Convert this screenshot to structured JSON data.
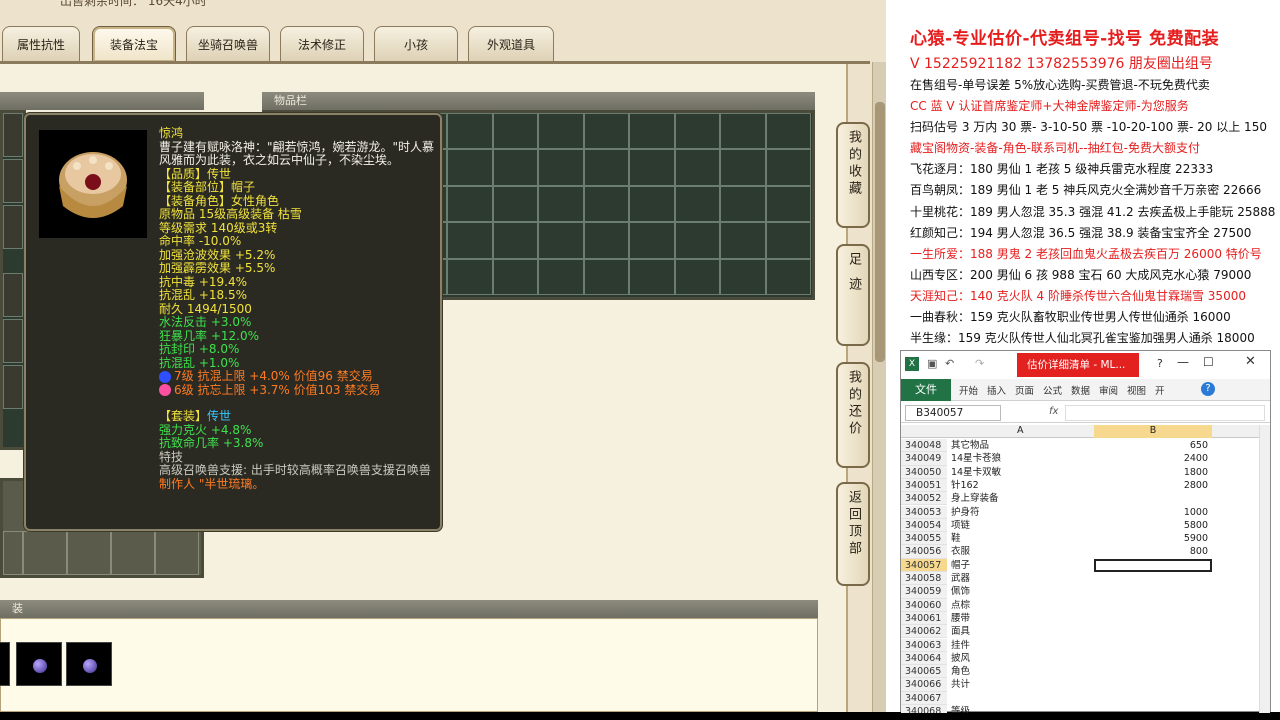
{
  "game": {
    "top_text": "出售剩余时间：  16天4小时",
    "tabs": [
      "属性抗性",
      "装备法宝",
      "坐骑召唤兽",
      "法术修正",
      "小孩",
      "外观道具"
    ],
    "active_tab": "装备法宝",
    "inventory_header": "物品栏",
    "bottom_section_header": "装",
    "side_buttons": [
      "我的收藏",
      "足迹",
      "我的还价",
      "返回顶部"
    ]
  },
  "tooltip": {
    "item_name": "惊鸿",
    "description": "曹子建有赋咏洛神：\"翩若惊鸿，婉若游龙。\"时人慕风雅而为此装，衣之如云中仙子，不染尘埃。",
    "lines": [
      {
        "text": "【品质】传世",
        "color": "y"
      },
      {
        "text": "【装备部位】帽子",
        "color": "y"
      },
      {
        "text": "【装备角色】女性角色",
        "color": "y"
      },
      {
        "text": "原物品 15级高级装备 枯雪",
        "color": "y"
      },
      {
        "text": "等级需求 140级或3转",
        "color": "y"
      },
      {
        "text": "命中率 -10.0%",
        "color": "y"
      },
      {
        "text": "加强沧波效果 +5.2%",
        "color": "y"
      },
      {
        "text": "加强霹雳效果 +5.5%",
        "color": "y"
      },
      {
        "text": "抗中毒 +19.4%",
        "color": "y"
      },
      {
        "text": "抗混乱 +18.5%",
        "color": "y"
      },
      {
        "text": "耐久 1494/1500",
        "color": "y"
      },
      {
        "text": "水法反击 +3.0%",
        "color": "g"
      },
      {
        "text": "狂暴几率 +12.0%",
        "color": "g"
      },
      {
        "text": "抗封印 +8.0%",
        "color": "g"
      },
      {
        "text": "抗混乱 +1.0%",
        "color": "g"
      }
    ],
    "gems": [
      {
        "text": "7级 抗混上限 +4.0% 价值96 禁交易",
        "color": "#2f4fff"
      },
      {
        "text": "6级 抗忘上限 +3.7% 价值103 禁交易",
        "color": "#ff4fa0"
      }
    ],
    "set_label": "【套装】",
    "set_name": "传世",
    "set_lines": [
      "强力克火 +4.8%",
      "抗致命几率 +3.8%"
    ],
    "special_label": "特技",
    "special_text": "高级召唤兽支援: 出手时较高概率召唤兽支援召唤兽",
    "maker": "制作人 \"半世琉璃。"
  },
  "right": {
    "title": "心猿-专业估价-代卖组号-找号 免费配装",
    "lines": [
      {
        "text": "V 15225921182   13782553976 朋友圈出组号",
        "cls": "red big"
      },
      {
        "text": "在售组号-单号误差 5%放心选购-买费管退-不玩免费代卖",
        "cls": ""
      },
      {
        "text": "CC 蓝 V 认证首席鉴定师+大神金牌鉴定师-为您服务",
        "cls": "red"
      },
      {
        "text": "扫码估号 3 万内 30 票- 3-10-50 票  -10-20-100 票- 20 以上 150",
        "cls": ""
      },
      {
        "text": "藏宝阁物资-装备-角色-联系司机--抽红包-免费大额支付",
        "cls": "red"
      },
      {
        "text": "飞花逐月：180 男仙 1 老孩 5 级神兵雷克水程度 22333",
        "cls": ""
      },
      {
        "text": "百鸟朝凤：189 男仙 1 老 5 神兵风克火全满妙音千万亲密 22666",
        "cls": ""
      },
      {
        "text": "十里桃花：189 男人忽混 35.3 强混 41.2 去疾孟极上手能玩 25888",
        "cls": ""
      },
      {
        "text": "红颜知己：194 男人忽混 36.5 强混 38.9 装备宝宝齐全 27500",
        "cls": ""
      },
      {
        "text": "一生所爱：188 男鬼 2 老孩回血鬼火孟极去疾百万 26000 特价号",
        "cls": "red"
      },
      {
        "text": "山西专区：200 男仙 6 孩 988 宝石 60 大成风克水心猿 79000",
        "cls": ""
      },
      {
        "text": "天涯知己：140 克火队 4 阶睡杀传世六合仙鬼甘霖瑞雪 35000",
        "cls": "red"
      },
      {
        "text": "一曲春秋：159 克火队畜牧职业传世男人传世仙通杀 16000",
        "cls": ""
      },
      {
        "text": "半生缘：159 克火队传世人仙北冥孔雀宝鉴加强男人通杀 18000",
        "cls": ""
      }
    ]
  },
  "excel": {
    "title": "估价详细清单 - ML...",
    "ribbon_file": "文件",
    "ribbon_tabs": [
      "开始",
      "插入",
      "页面",
      "公式",
      "数据",
      "审阅",
      "视图",
      "开"
    ],
    "namebox": "B340057",
    "fx": "fx",
    "col_a": "A",
    "col_b": "B",
    "rows": [
      {
        "n": "340048",
        "a": "其它物品",
        "b": "650"
      },
      {
        "n": "340049",
        "a": "14星卡苍狼",
        "b": "2400"
      },
      {
        "n": "340050",
        "a": "14星卡双敏",
        "b": "1800"
      },
      {
        "n": "340051",
        "a": "针162",
        "b": "2800"
      },
      {
        "n": "340052",
        "a": "身上穿装备",
        "b": ""
      },
      {
        "n": "340053",
        "a": "护身符",
        "b": "1000"
      },
      {
        "n": "340054",
        "a": "项链",
        "b": "5800"
      },
      {
        "n": "340055",
        "a": "鞋",
        "b": "5900"
      },
      {
        "n": "340056",
        "a": "衣服",
        "b": "800"
      },
      {
        "n": "340057",
        "a": "帽子",
        "b": ""
      },
      {
        "n": "340058",
        "a": "武器",
        "b": ""
      },
      {
        "n": "340059",
        "a": "佩饰",
        "b": ""
      },
      {
        "n": "340060",
        "a": "点棕",
        "b": ""
      },
      {
        "n": "340061",
        "a": "腰带",
        "b": ""
      },
      {
        "n": "340062",
        "a": "面具",
        "b": ""
      },
      {
        "n": "340063",
        "a": "挂件",
        "b": ""
      },
      {
        "n": "340064",
        "a": "披风",
        "b": ""
      },
      {
        "n": "340065",
        "a": "角色",
        "b": ""
      },
      {
        "n": "340066",
        "a": "共计",
        "b": ""
      },
      {
        "n": "340067",
        "a": "",
        "b": ""
      },
      {
        "n": "340068",
        "a": "等级",
        "b": ""
      }
    ]
  }
}
